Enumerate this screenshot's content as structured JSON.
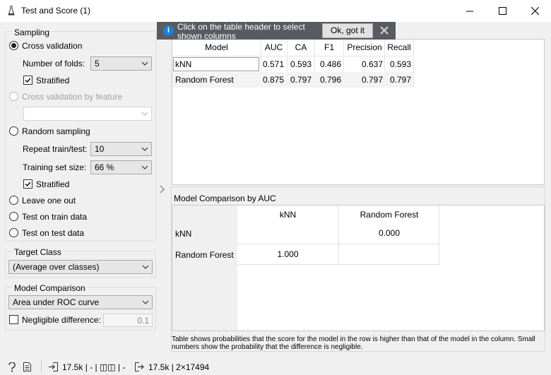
{
  "window": {
    "title": "Test and Score (1)"
  },
  "sampling": {
    "title": "Sampling",
    "cross_validation": "Cross validation",
    "num_folds_label": "Number of folds:",
    "num_folds_value": "5",
    "stratified_label": "Stratified",
    "cv_by_feature": "Cross validation by feature",
    "random_sampling": "Random sampling",
    "repeat_label": "Repeat train/test:",
    "repeat_value": "10",
    "train_size_label": "Training set size:",
    "train_size_value": "66 %",
    "stratified2_label": "Stratified",
    "leave_one_out": "Leave one out",
    "test_on_train": "Test on train data",
    "test_on_test": "Test on test data"
  },
  "target_class": {
    "title": "Target Class",
    "value": "(Average over classes)"
  },
  "model_comparison": {
    "title": "Model Comparison",
    "value": "Area under ROC curve",
    "negligible_label": "Negligible difference:",
    "negligible_value": "0.1"
  },
  "info": {
    "text": "Click on the table header to select shown columns",
    "ok_label": "Ok, got it"
  },
  "scores": {
    "headers": [
      "Model",
      "AUC",
      "CA",
      "F1",
      "Precision",
      "Recall"
    ],
    "rows": [
      [
        "kNN",
        "0.571",
        "0.593",
        "0.486",
        "0.637",
        "0.593"
      ],
      [
        "Random Forest",
        "0.875",
        "0.797",
        "0.796",
        "0.797",
        "0.797"
      ]
    ]
  },
  "comparison": {
    "title": "Model Comparison by AUC",
    "col_headers": [
      "kNN",
      "Random Forest"
    ],
    "row_headers": [
      "kNN",
      "Random Forest"
    ],
    "knn_vs_rf": "0.000",
    "rf_vs_knn": "1.000",
    "footnote": "Table shows probabilities that the score for the model in the row is higher than that of the model in the column. Small numbers show the probability that the difference is negligible."
  },
  "status": {
    "input_summary": "17.5k | - | ◫◫ | -",
    "output_summary": "17.5k | 2×17494"
  }
}
